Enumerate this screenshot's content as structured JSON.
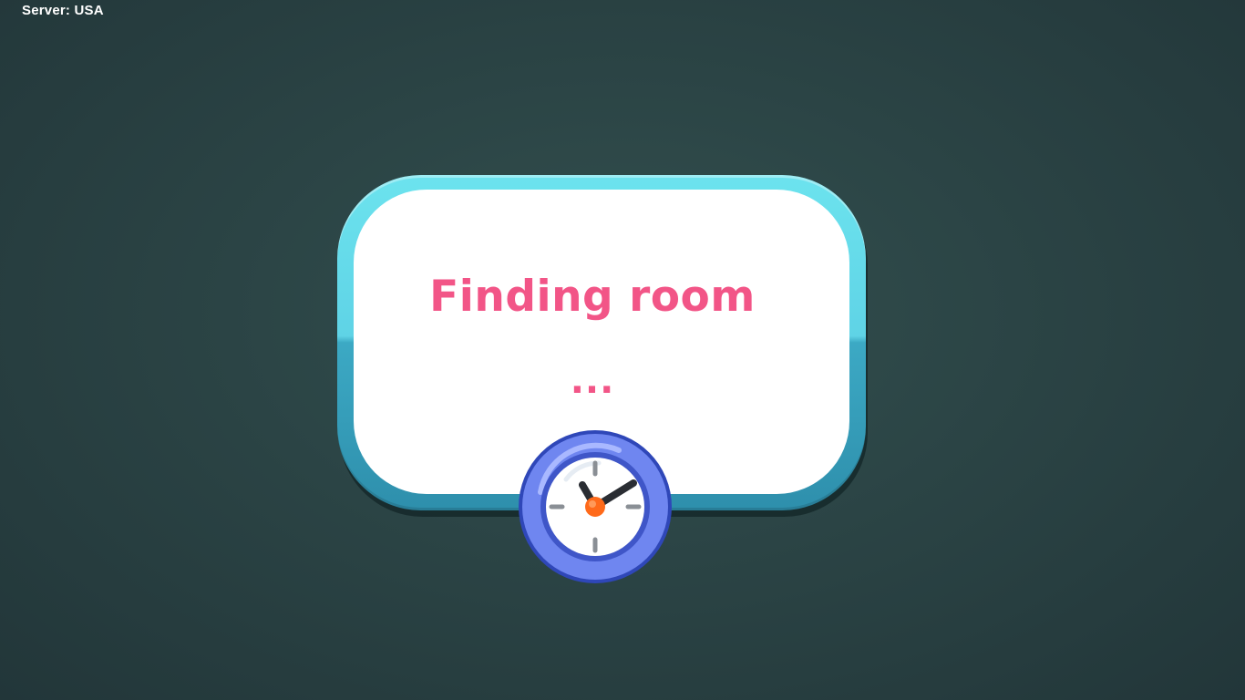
{
  "server": {
    "label": "Server: USA"
  },
  "dialog": {
    "title": "Finding room",
    "dots": "...",
    "icon": "clock-icon"
  },
  "colors": {
    "title": "#f25587",
    "frame_top": "#6ce3ee",
    "frame_bottom": "#2e8fac",
    "clock_ring": "#6f86f0",
    "clock_center": "#ff6a1a"
  }
}
